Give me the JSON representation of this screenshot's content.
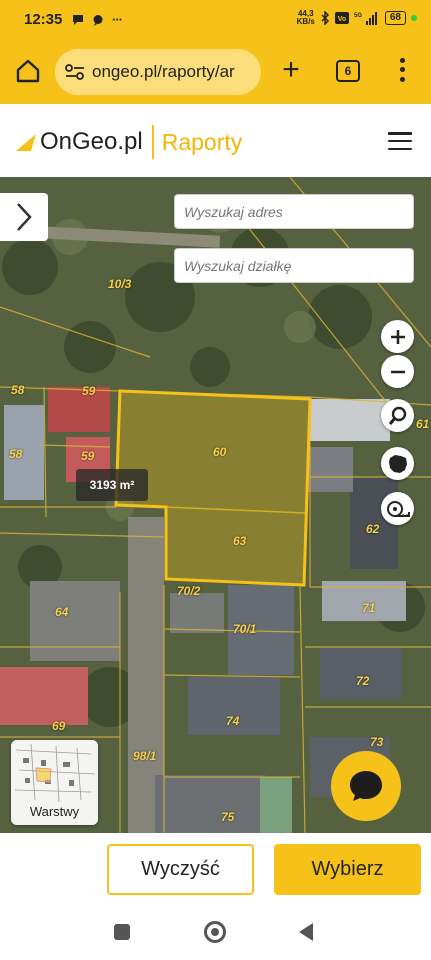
{
  "status_bar": {
    "time": "12:35",
    "net_speed_value": "44,3",
    "net_speed_unit": "KB/s",
    "battery": "68"
  },
  "browser": {
    "url": "ongeo.pl/raporty/ar",
    "tab_count": "6"
  },
  "header": {
    "brand": "OnGeo.pl",
    "section": "Raporty"
  },
  "map": {
    "search_address_placeholder": "Wyszukaj adres",
    "search_parcel_placeholder": "Wyszukaj działkę",
    "area_badge": "3193 m²",
    "layers_label": "Warstwy",
    "parcel_labels": [
      "10/3",
      "58",
      "59",
      "58",
      "59",
      "60",
      "63",
      "70/2",
      "70/1",
      "64",
      "71",
      "62",
      "72",
      "69",
      "74",
      "73",
      "98/1",
      "75",
      "61"
    ]
  },
  "actions": {
    "clear_label": "Wyczyść",
    "choose_label": "Wybierz"
  },
  "colors": {
    "brand_yellow": "#F6C21A",
    "parcel_highlight": "#F6C21A"
  }
}
